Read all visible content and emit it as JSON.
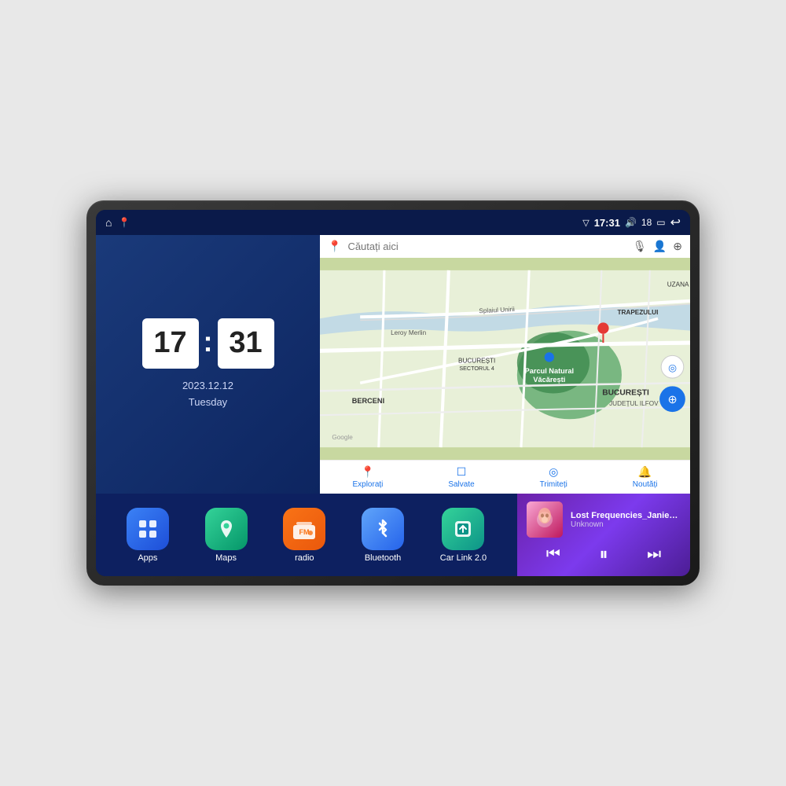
{
  "device": {
    "title": "Car Android Head Unit"
  },
  "statusBar": {
    "signal_icon": "▽",
    "time": "17:31",
    "volume_icon": "🔊",
    "volume_level": "18",
    "battery_icon": "▭",
    "back_icon": "↩",
    "home_icon": "⌂",
    "maps_icon": "📍"
  },
  "clock": {
    "hours": "17",
    "minutes": "31",
    "date": "2023.12.12",
    "day": "Tuesday"
  },
  "map": {
    "search_placeholder": "Căutați aici",
    "location_label1": "Parcul Natural Văcărești",
    "location_label2": "BUCUREȘTI",
    "location_label3": "JUDEȚUL ILFOV",
    "location_label4": "BERCENI",
    "location_label5": "TRAPEZULUI",
    "location_label6": "Leroy Merlin",
    "location_label7": "BUCUREȘTI SECTORUL 4",
    "location_label8": "Splaiul Unirii",
    "branding": "Google",
    "nav_items": [
      {
        "label": "Explorați",
        "icon": "📍",
        "active": true
      },
      {
        "label": "Salvate",
        "icon": "☐",
        "active": false
      },
      {
        "label": "Trimiteți",
        "icon": "◎",
        "active": false
      },
      {
        "label": "Noutăți",
        "icon": "🔔",
        "active": false
      }
    ]
  },
  "apps": [
    {
      "id": "apps",
      "label": "Apps",
      "icon": "⊞",
      "color_class": "icon-apps"
    },
    {
      "id": "maps",
      "label": "Maps",
      "icon": "🗺",
      "color_class": "icon-maps"
    },
    {
      "id": "radio",
      "label": "radio",
      "icon": "📻",
      "color_class": "icon-radio"
    },
    {
      "id": "bluetooth",
      "label": "Bluetooth",
      "icon": "𝔅",
      "color_class": "icon-bluetooth"
    },
    {
      "id": "carlink",
      "label": "Car Link 2.0",
      "icon": "📱",
      "color_class": "icon-carlink"
    }
  ],
  "music": {
    "title": "Lost Frequencies_Janieck Devy-...",
    "artist": "Unknown",
    "prev_icon": "⏮",
    "play_icon": "⏸",
    "next_icon": "⏭"
  }
}
